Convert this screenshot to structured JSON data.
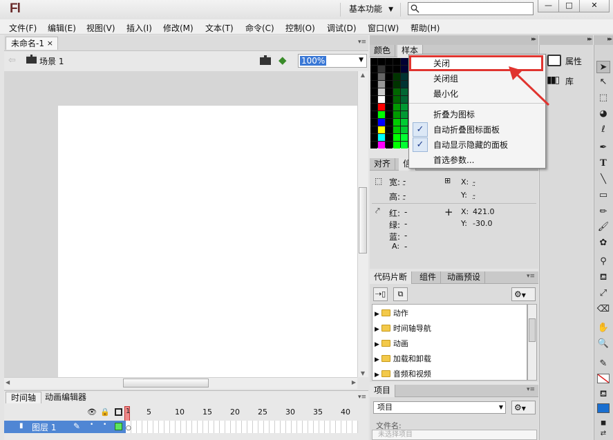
{
  "app": {
    "logo": "Fl",
    "workspace": "基本功能"
  },
  "window_controls": {
    "minimize": "—",
    "maximize": "□",
    "close": "✕"
  },
  "menu": [
    "文件(F)",
    "编辑(E)",
    "视图(V)",
    "插入(I)",
    "修改(M)",
    "文本(T)",
    "命令(C)",
    "控制(O)",
    "调试(D)",
    "窗口(W)",
    "帮助(H)"
  ],
  "document": {
    "tab": "未命名-1",
    "close": "×",
    "scene": "场景 1",
    "zoom": "100%"
  },
  "timeline": {
    "tabs": [
      "时间轴",
      "动画编辑器"
    ],
    "frame_numbers": [
      "1",
      "5",
      "10",
      "15",
      "20",
      "25",
      "30",
      "35",
      "40"
    ],
    "layer": "图层 1"
  },
  "color_panel": {
    "tabs": [
      "颜色",
      "样本"
    ]
  },
  "context_menu": {
    "items": [
      "关闭",
      "关闭组",
      "最小化",
      "折叠为图标",
      "自动折叠图标面板",
      "自动显示隐藏的面板",
      "首选参数..."
    ],
    "checked": [
      false,
      false,
      false,
      false,
      true,
      true,
      false
    ]
  },
  "align_panel": {
    "tabs": [
      "对齐",
      "信"
    ],
    "labels": {
      "width": "宽:",
      "height": "高:",
      "x": "X:",
      "y": "Y:",
      "red": "红:",
      "green": "绿:",
      "blue": "蓝:",
      "alpha": "A:"
    },
    "values": {
      "width": "-",
      "height": "-",
      "x_top": "-",
      "y_top": "-",
      "red": "-",
      "green": "-",
      "blue": "-",
      "alpha": "-",
      "x": "421.0",
      "y": "-30.0"
    }
  },
  "code_panel": {
    "tabs": [
      "代码片断",
      "组件",
      "动画预设"
    ],
    "items": [
      "动作",
      "时间轴导航",
      "动画",
      "加载和卸载",
      "音频和视频"
    ]
  },
  "project_panel": {
    "tab": "项目",
    "select": "项目",
    "filename_label": "文件名:",
    "placeholder": "未选择项目"
  },
  "side_panels": {
    "properties": "属性",
    "library": "库"
  },
  "accent": {
    "selection": "#3a78d6",
    "highlight_border": "#e0342f",
    "stage": "#ffffff"
  }
}
